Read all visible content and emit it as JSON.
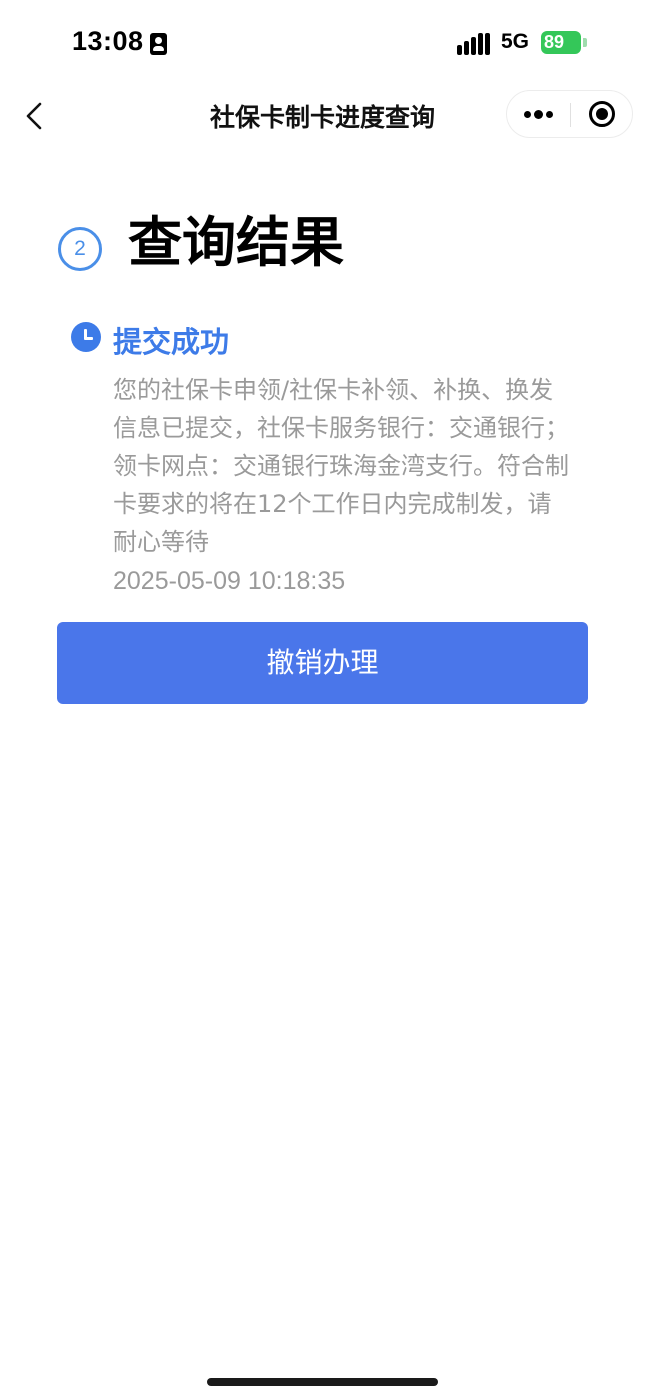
{
  "status_bar": {
    "time": "13:08",
    "network": "5G",
    "battery": "89",
    "icons": [
      "id-card-icon",
      "signal-icon",
      "battery-charging-icon"
    ]
  },
  "nav": {
    "title": "社保卡制卡进度查询",
    "icons": [
      "chevron-left-icon",
      "more-dots-icon",
      "target-icon"
    ]
  },
  "step": {
    "number": "2",
    "heading": "查询结果"
  },
  "status": {
    "icon": "clock-icon",
    "title": "提交成功",
    "description": "您的社保卡申领/社保卡补领、补换、换发信息已提交，社保卡服务银行：交通银行；领卡网点：交通银行珠海金湾支行。符合制卡要求的将在12个工作日内完成制发，请耐心等待",
    "timestamp": "2025-05-09 10:18:35"
  },
  "actions": {
    "cancel_label": "撤销办理"
  },
  "colors": {
    "accent": "#3d7be8",
    "button": "#4a76ea",
    "muted_text": "#9a9a9a",
    "battery": "#34c759"
  }
}
